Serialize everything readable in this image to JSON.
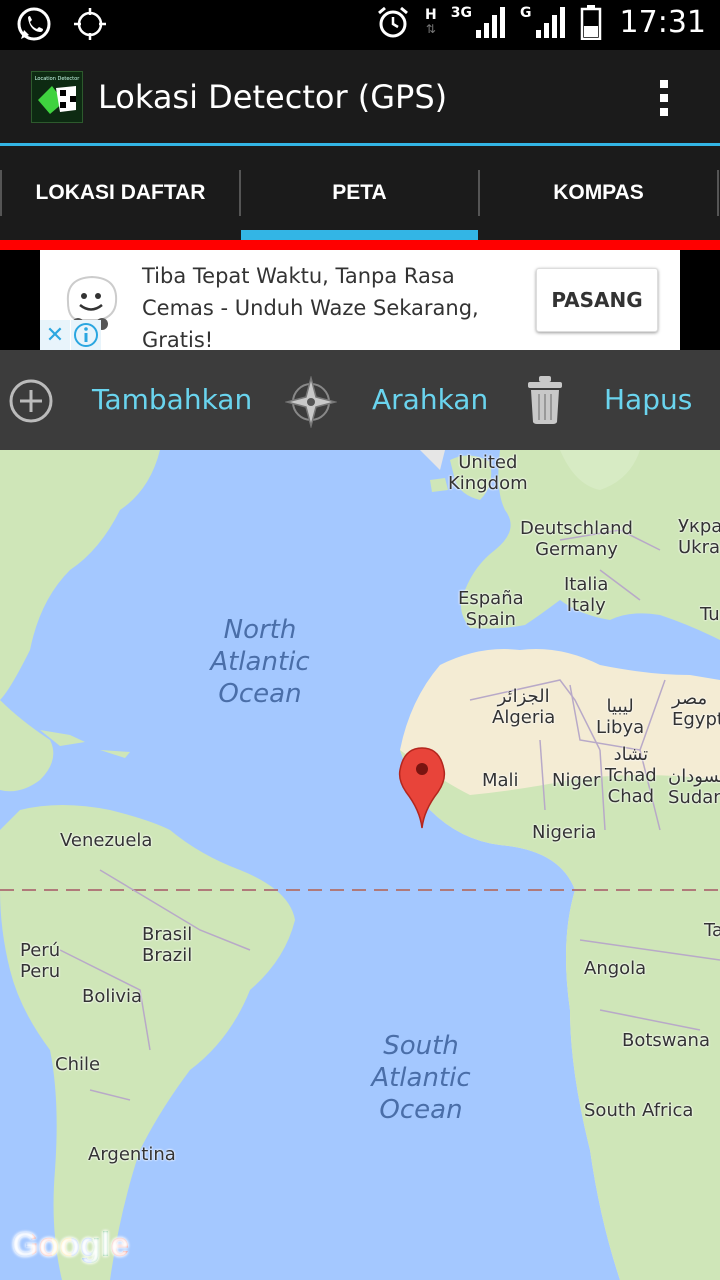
{
  "status_bar": {
    "time": "17:31",
    "net1": "H",
    "net2": "3G",
    "net3": "G"
  },
  "app": {
    "title": "Lokasi Detector (GPS)",
    "icon_caption": "Location Detector"
  },
  "tabs": [
    {
      "label": "LOKASI DAFTAR"
    },
    {
      "label": "PETA",
      "selected": true
    },
    {
      "label": "KOMPAS"
    }
  ],
  "ad": {
    "text": "Tiba Tepat Waktu, Tanpa Rasa Cemas - Unduh Waze Sekarang, Gratis!",
    "button": "PASANG"
  },
  "toolbar": {
    "add_label": "Tambahkan",
    "navigate_label": "Arahkan",
    "delete_label": "Hapus"
  },
  "map": {
    "labels": {
      "uk": "United\nKingdom",
      "germany": "Deutschland\nGermany",
      "ukraine": "Укра\nUkra",
      "spain": "España\nSpain",
      "italy": "Italia\nItaly",
      "tunisia": "Tu",
      "algeria": "الجزائر\nAlgeria",
      "libya": "ليبيا\nLibya",
      "egypt": "مصر\nEgypt",
      "mali": "Mali",
      "niger": "Niger",
      "chad": "تشاد\nTchad\nChad",
      "sudan": "السودان\nSudan",
      "nigeria": "Nigeria",
      "venezuela": "Venezuela",
      "brazil": "Brasil\nBrazil",
      "peru": "Perú\nPeru",
      "bolivia": "Bolivia",
      "chile": "Chile",
      "argentina": "Argentina",
      "angola": "Angola",
      "botswana": "Botswana",
      "south_africa": "South Africa",
      "tanzania": "Ta"
    },
    "oceans": {
      "north_atlantic": "North\nAtlantic\nOcean",
      "south_atlantic": "South\nAtlantic\nOcean"
    },
    "attribution": "Google"
  },
  "colors": {
    "accent": "#33b5e5",
    "toolbar_text": "#6ad4ee",
    "water": "#a4c8ff",
    "land": "#cfe6b8",
    "marker": "#e8443a"
  }
}
